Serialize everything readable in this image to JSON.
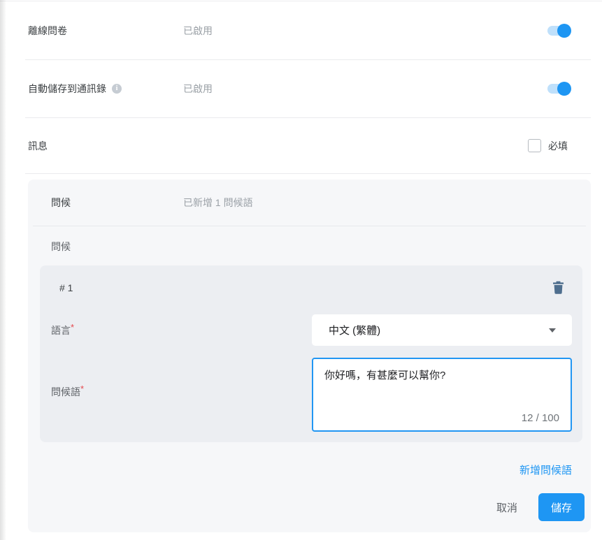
{
  "colors": {
    "accent_blue": "#1e96f3",
    "toggle_track_blue": "#bfe0fb",
    "panel_bg": "#f6f7f9",
    "card_bg": "#eceef2",
    "trash_icon_color": "#4e6e8e",
    "required_red": "#e5484d"
  },
  "toggle_rows": [
    {
      "label": "離線問卷",
      "status": "已啟用",
      "enabled": true
    },
    {
      "label": "自動儲存到通訊錄",
      "status": "已啟用",
      "enabled": true,
      "info_icon_glyph": "i"
    }
  ],
  "message_row": {
    "label": "訊息",
    "required_checkbox_label": "必填",
    "checked": false
  },
  "greeting_panel": {
    "header_label": "問候",
    "header_status": "已新增 1 問候語",
    "section_label": "問候",
    "card": {
      "index_label": "# 1",
      "language_label": "語言",
      "required_mark": "*",
      "language_value": "中文 (繁體)",
      "greeting_label": "問候語",
      "greeting_value": "你好嗎，有甚麼可以幫你?",
      "char_counter": "12 / 100"
    },
    "add_greeting_link": "新增問候語"
  },
  "actions": {
    "cancel_label": "取消",
    "save_label": "儲存"
  }
}
